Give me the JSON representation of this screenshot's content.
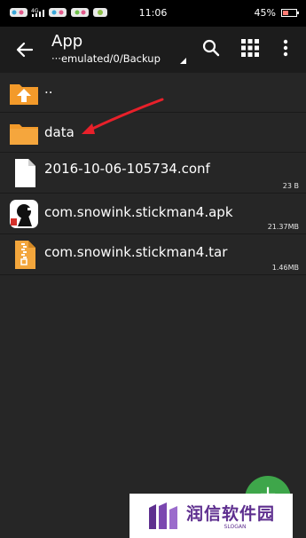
{
  "status_bar": {
    "time": "11:06",
    "battery": "45%",
    "battery_level": 0.45,
    "signal_label": "4G"
  },
  "toolbar": {
    "title": "App",
    "path": "···emulated/0/Backup",
    "icons": [
      "back-arrow-icon",
      "search-icon",
      "grid-icon",
      "more-vert-icon"
    ]
  },
  "files": [
    {
      "name": "..",
      "size": "",
      "icon": "folder-up-icon"
    },
    {
      "name": "data",
      "size": "",
      "icon": "folder-icon"
    },
    {
      "name": "2016-10-06-105734.conf",
      "size": "23 B",
      "icon": "document-icon"
    },
    {
      "name": "com.snowink.stickman4.apk",
      "size": "21.37MB",
      "icon": "app-icon"
    },
    {
      "name": "com.snowink.stickman4.tar",
      "size": "1.46MB",
      "icon": "archive-icon"
    }
  ],
  "colors": {
    "folder": "#f39a2a",
    "background": "#262626",
    "toolbar": "#1c1c1c",
    "fab": "#3ea64a",
    "annotation": "#e8202a",
    "watermark": "#5e2f8f"
  },
  "fab": {
    "label": "+"
  },
  "watermark": {
    "text": "润信软件园",
    "subtext": "SLOGAN"
  }
}
